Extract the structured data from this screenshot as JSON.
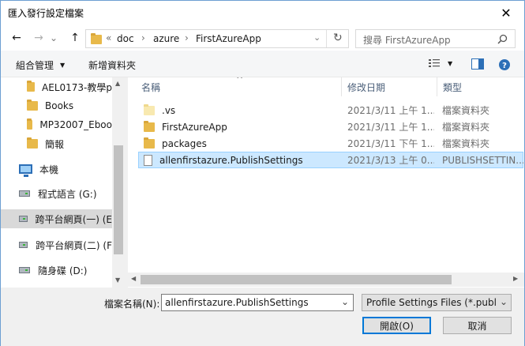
{
  "window": {
    "title": "匯入發行設定檔案",
    "close_glyph": "✕"
  },
  "nav": {
    "back_glyph": "←",
    "forward_glyph": "→",
    "history_glyph": "⌄",
    "up_glyph": "↑",
    "breadcrumb_overflow": "«",
    "breadcrumb": [
      "doc",
      "azure",
      "FirstAzureApp"
    ],
    "crumb_sep": "›",
    "refresh_glyph": "↻",
    "search_placeholder": "搜尋 FirstAzureApp"
  },
  "toolbar": {
    "organize_label": "組合管理",
    "organize_caret": "▼",
    "new_folder_label": "新增資料夾",
    "view_caret": "▼"
  },
  "sidebar": {
    "items": [
      {
        "label": "AEL0173-教學p",
        "icon": "folder-icon",
        "kind": "folder"
      },
      {
        "label": "Books",
        "icon": "folder-icon",
        "kind": "folder"
      },
      {
        "label": "MP32007_Eboo",
        "icon": "folder-icon",
        "kind": "folder"
      },
      {
        "label": "簡報",
        "icon": "folder-icon",
        "kind": "folder"
      },
      {
        "label": "本機",
        "icon": "computer-icon",
        "kind": "pc"
      },
      {
        "label": "程式語言 (G:)",
        "icon": "drive-icon",
        "kind": "drive"
      },
      {
        "label": "跨平台網頁(一) (E",
        "icon": "drive-icon",
        "kind": "drive",
        "selected": true
      },
      {
        "label": "跨平台網頁(二) (F",
        "icon": "drive-icon",
        "kind": "drive"
      },
      {
        "label": "隨身碟 (D:)",
        "icon": "drive-icon",
        "kind": "drive"
      }
    ]
  },
  "file_list": {
    "columns": {
      "name": "名稱",
      "date": "修改日期",
      "type": "類型"
    },
    "sort_glyph": "^",
    "rows": [
      {
        "name": ".vs",
        "date": "2021/3/11 上午 1...",
        "type": "檔案資料夾",
        "icon": "folder-icon",
        "light": true
      },
      {
        "name": "FirstAzureApp",
        "date": "2021/3/11 上午 1...",
        "type": "檔案資料夾",
        "icon": "folder-icon"
      },
      {
        "name": "packages",
        "date": "2021/3/11 下午 1...",
        "type": "檔案資料夾",
        "icon": "folder-icon"
      },
      {
        "name": "allenfirstazure.PublishSettings",
        "date": "2021/3/13 上午 0...",
        "type": "PUBLISHSETTIN...",
        "icon": "file-icon",
        "selected": true
      }
    ]
  },
  "footer": {
    "filename_label": "檔案名稱(N):",
    "filename_value": "allenfirstazure.PublishSettings",
    "filter_value": "Profile Settings Files (*.publish",
    "open_label": "開啟(O)",
    "cancel_label": "取消",
    "dropdown_glyph": "⌄"
  },
  "colors": {
    "accent": "#0078d7",
    "selection": "#cce8ff",
    "folder": "#e8b94a"
  }
}
